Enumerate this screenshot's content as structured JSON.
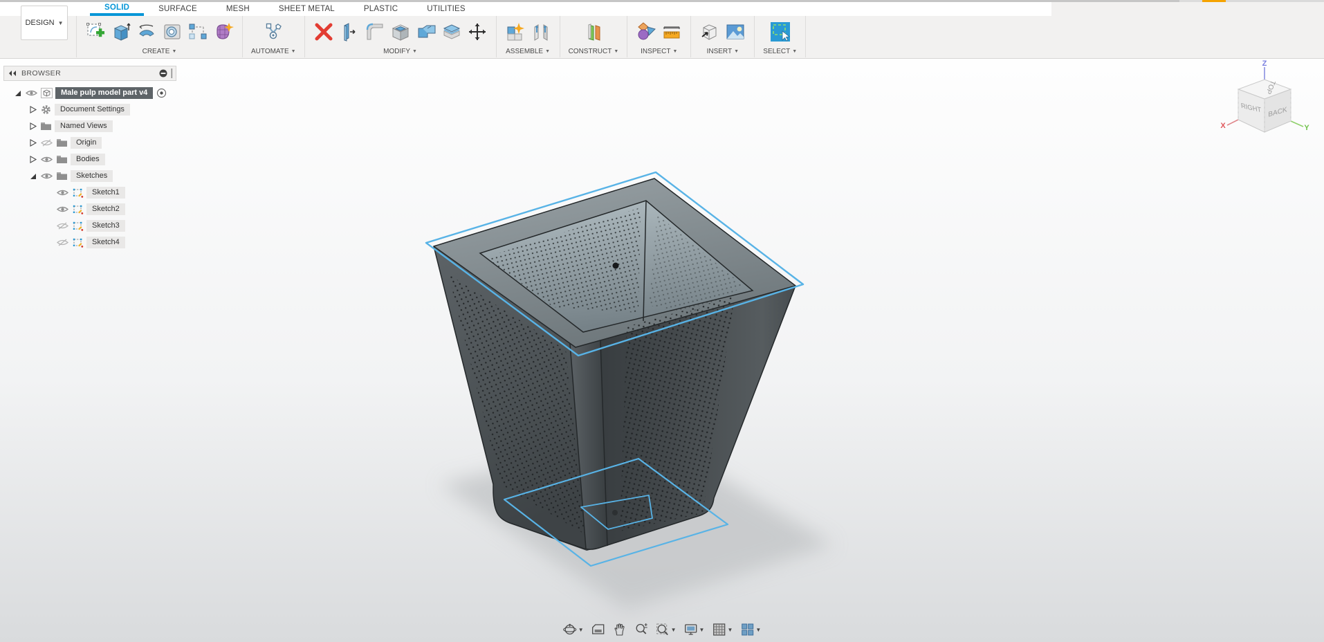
{
  "window": {
    "top_strip": {
      "base_color": "#c9c9c9",
      "accent_color": "#f5a300"
    }
  },
  "header": {
    "design_menu": {
      "label": "DESIGN"
    },
    "tabs": [
      {
        "label": "SOLID",
        "active": true
      },
      {
        "label": "SURFACE",
        "active": false
      },
      {
        "label": "MESH",
        "active": false
      },
      {
        "label": "SHEET METAL",
        "active": false
      },
      {
        "label": "PLASTIC",
        "active": false
      },
      {
        "label": "UTILITIES",
        "active": false
      }
    ],
    "active_tab_color": "#0696d7"
  },
  "toolbar": {
    "groups": [
      {
        "label": "CREATE"
      },
      {
        "label": "AUTOMATE"
      },
      {
        "label": "MODIFY"
      },
      {
        "label": "ASSEMBLE"
      },
      {
        "label": "CONSTRUCT"
      },
      {
        "label": "INSPECT"
      },
      {
        "label": "INSERT"
      },
      {
        "label": "SELECT"
      }
    ]
  },
  "browser": {
    "title": "BROWSER",
    "root": {
      "label": "Male pulp model part v4",
      "selected": true,
      "visible": true
    },
    "items": [
      {
        "label": "Document Settings",
        "icon": "gear",
        "expander": "collapsed"
      },
      {
        "label": "Named Views",
        "icon": "folder",
        "expander": "collapsed"
      },
      {
        "label": "Origin",
        "icon": "folder",
        "expander": "collapsed",
        "visible": false
      },
      {
        "label": "Bodies",
        "icon": "folder",
        "expander": "collapsed",
        "visible": true
      },
      {
        "label": "Sketches",
        "icon": "folder",
        "expander": "expanded",
        "visible": true
      },
      {
        "label": "Sketch1",
        "icon": "sketch",
        "visible": true
      },
      {
        "label": "Sketch2",
        "icon": "sketch",
        "visible": true
      },
      {
        "label": "Sketch3",
        "icon": "sketch",
        "visible": false
      },
      {
        "label": "Sketch4",
        "icon": "sketch",
        "visible": false
      }
    ]
  },
  "viewcube": {
    "faces": {
      "top": "TOP",
      "left": "RIGHT",
      "right": "BACK"
    },
    "axes": {
      "x": "X",
      "y": "Y",
      "z": "Z"
    },
    "axis_colors": {
      "x": "#e0565a",
      "y": "#6fc24b",
      "z": "#7a7fe0"
    }
  },
  "canvas": {
    "sketch_highlight_color": "#58b3e6",
    "model_color_dark": "#3e4346",
    "model_color_light": "#9fadb3"
  },
  "nav_bar": {
    "buttons": [
      {
        "name": "orbit",
        "has_dropdown": true
      },
      {
        "name": "look-at",
        "has_dropdown": false
      },
      {
        "name": "pan",
        "has_dropdown": false
      },
      {
        "name": "zoom",
        "has_dropdown": false
      },
      {
        "name": "fit",
        "has_dropdown": true
      },
      {
        "name": "display-settings",
        "has_dropdown": true
      },
      {
        "name": "grid-layout",
        "has_dropdown": true
      },
      {
        "name": "viewports",
        "has_dropdown": true
      }
    ]
  }
}
